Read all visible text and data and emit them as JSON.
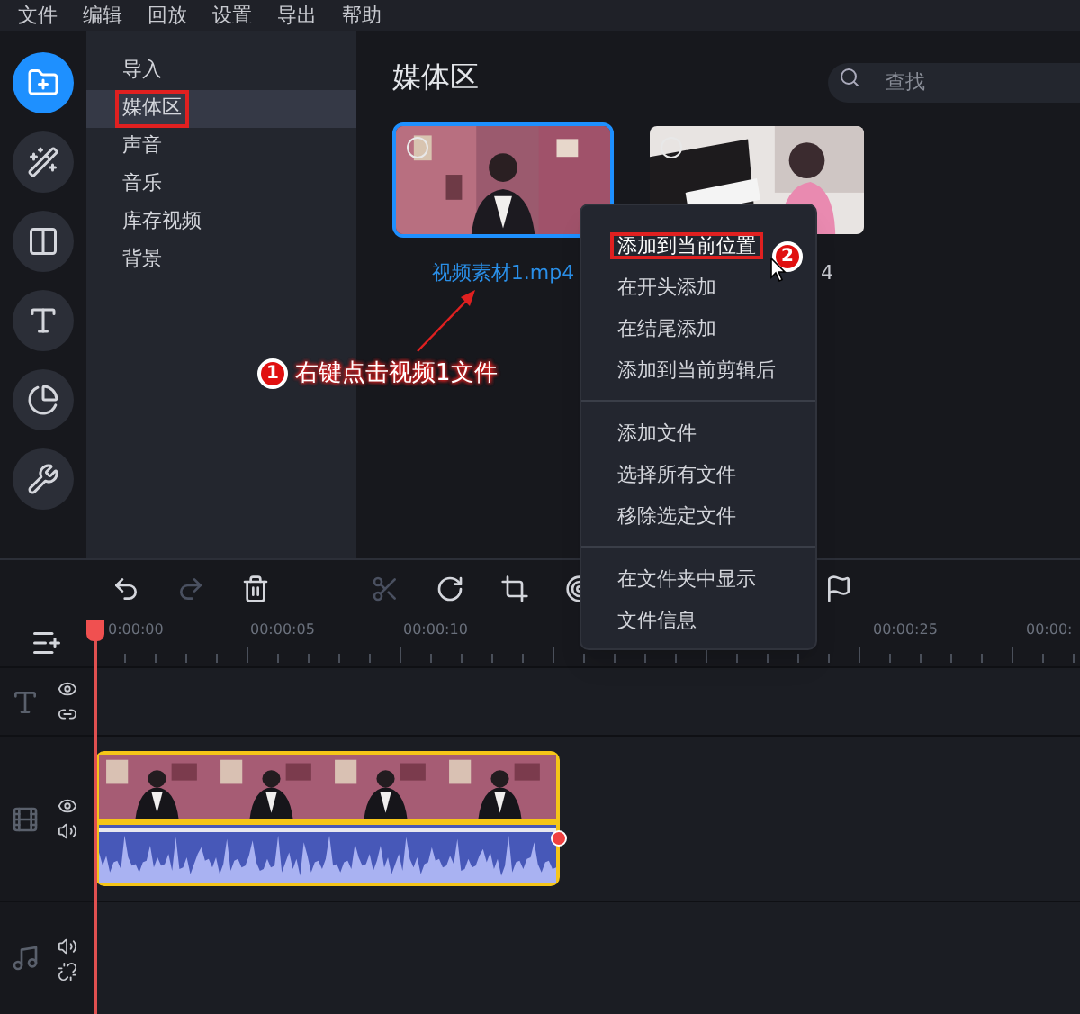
{
  "menu_bar": [
    "文件",
    "编辑",
    "回放",
    "设置",
    "导出",
    "帮助"
  ],
  "tool_rail": [
    {
      "kind": "import",
      "selected": true
    },
    {
      "kind": "wand",
      "selected": false
    },
    {
      "kind": "transition",
      "selected": false
    },
    {
      "kind": "titles",
      "selected": false
    },
    {
      "kind": "timer",
      "selected": false
    },
    {
      "kind": "tools",
      "selected": false
    }
  ],
  "nav": [
    {
      "label": "导入",
      "selected": false
    },
    {
      "label": "媒体区",
      "selected": true
    },
    {
      "label": "声音",
      "selected": false
    },
    {
      "label": "音乐",
      "selected": false
    },
    {
      "label": "库存视频",
      "selected": false
    },
    {
      "label": "背景",
      "selected": false
    }
  ],
  "media": {
    "title": "媒体区",
    "search": {
      "placeholder": "查找"
    },
    "items": [
      {
        "label": "视频素材1.mp4",
        "selected": true,
        "kind": "presenter"
      },
      {
        "label": "4",
        "selected": false,
        "kind": "piano"
      }
    ]
  },
  "context_menu": {
    "groups": [
      [
        {
          "label": "添加到当前位置",
          "selected": true
        },
        {
          "label": "在开头添加",
          "selected": false
        },
        {
          "label": "在结尾添加",
          "selected": false
        },
        {
          "label": "添加到当前剪辑后",
          "selected": false
        }
      ],
      [
        {
          "label": "添加文件",
          "selected": false
        },
        {
          "label": "选择所有文件",
          "selected": false
        },
        {
          "label": "移除选定文件",
          "selected": false
        }
      ],
      [
        {
          "label": "在文件夹中显示",
          "selected": false
        },
        {
          "label": "文件信息",
          "selected": false
        }
      ]
    ]
  },
  "annotations": [
    {
      "number": "1",
      "text": "右键点击视频1文件"
    },
    {
      "number": "2"
    }
  ],
  "toolbar": [
    {
      "kind": "undo",
      "disabled": false
    },
    {
      "kind": "redo",
      "disabled": true
    },
    {
      "kind": "delete",
      "disabled": false
    },
    {
      "kind": "cut",
      "disabled": true
    },
    {
      "kind": "rotate",
      "disabled": false
    },
    {
      "kind": "crop",
      "disabled": false
    },
    {
      "kind": "target",
      "disabled": false
    },
    {
      "kind": "flag",
      "disabled": false
    }
  ],
  "ruler": {
    "left": [
      "0:00:00",
      "00:00:05",
      "00:00:10"
    ],
    "right": [
      "00:00:25",
      "00:00:"
    ]
  },
  "tracks": [
    {
      "kind": "text"
    },
    {
      "kind": "video"
    },
    {
      "kind": "audio"
    }
  ]
}
